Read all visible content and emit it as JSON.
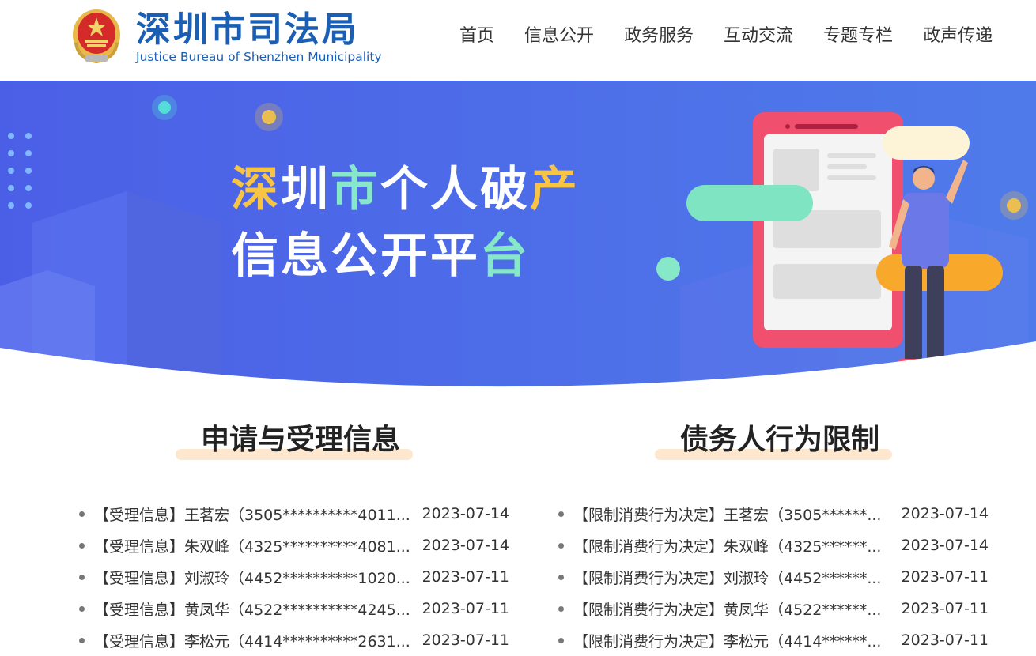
{
  "header": {
    "logo_cn": "深圳市司法局",
    "logo_en": "Justice Bureau of Shenzhen Municipality",
    "emblem_icon": "justice-emblem-icon"
  },
  "nav": {
    "items": [
      {
        "label": "首页"
      },
      {
        "label": "信息公开"
      },
      {
        "label": "政务服务"
      },
      {
        "label": "互动交流"
      },
      {
        "label": "专题专栏"
      },
      {
        "label": "政声传递"
      }
    ]
  },
  "banner": {
    "line1": {
      "c1": "深",
      "c2": "圳",
      "c3": "市",
      "c4": "个",
      "c5": "人",
      "c6": "破",
      "c7": "产"
    },
    "line2": {
      "c1": "信",
      "c2": "息",
      "c3": "公",
      "c4": "开",
      "c5": "平",
      "c6": "台"
    },
    "colors": {
      "background": "#4a63e8",
      "yellow": "#f7c444",
      "green": "#86e8c8",
      "phone": "#f0506e"
    }
  },
  "sections": [
    {
      "title": "申请与受理信息",
      "items": [
        {
          "text": "【受理信息】王茗宏（3505**********4011...",
          "date": "2023-07-14"
        },
        {
          "text": "【受理信息】朱双峰（4325**********4081...",
          "date": "2023-07-14"
        },
        {
          "text": "【受理信息】刘淑玲（4452**********1020...",
          "date": "2023-07-11"
        },
        {
          "text": "【受理信息】黄凤华（4522**********4245...",
          "date": "2023-07-11"
        },
        {
          "text": "【受理信息】李松元（4414**********2631...",
          "date": "2023-07-11"
        }
      ]
    },
    {
      "title": "债务人行为限制",
      "items": [
        {
          "text": "【限制消费行为决定】王茗宏（3505******...",
          "date": "2023-07-14"
        },
        {
          "text": "【限制消费行为决定】朱双峰（4325******...",
          "date": "2023-07-14"
        },
        {
          "text": "【限制消费行为决定】刘淑玲（4452******...",
          "date": "2023-07-11"
        },
        {
          "text": "【限制消费行为决定】黄凤华（4522******...",
          "date": "2023-07-11"
        },
        {
          "text": "【限制消费行为决定】李松元（4414******...",
          "date": "2023-07-11"
        }
      ]
    }
  ]
}
